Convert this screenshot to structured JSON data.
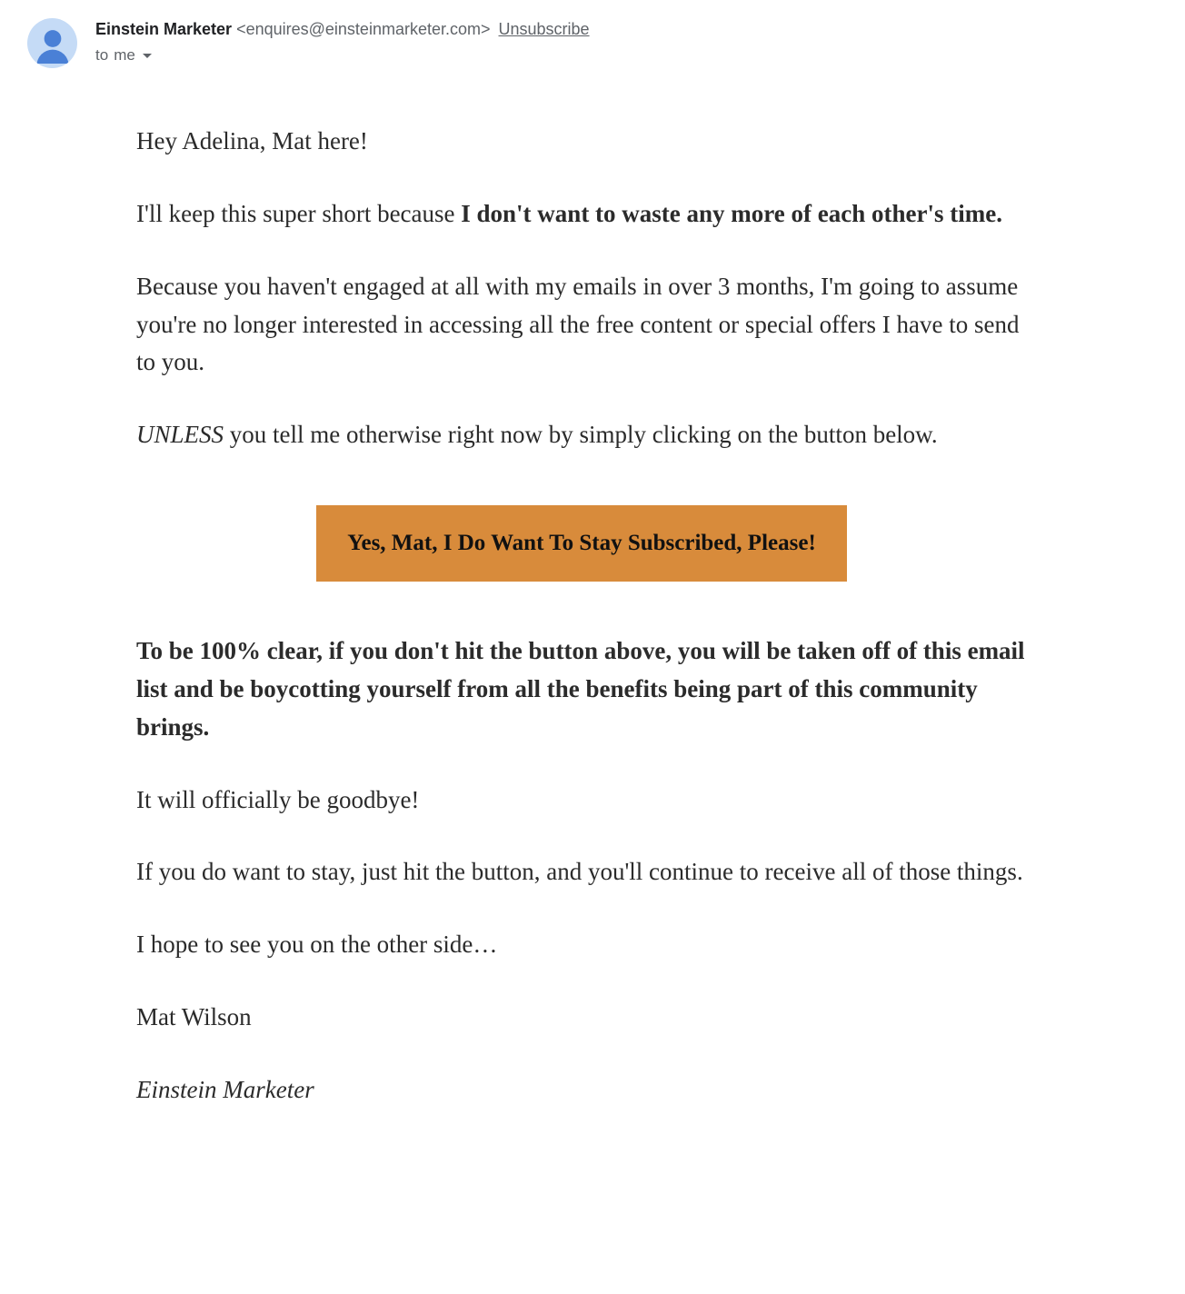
{
  "header": {
    "sender_name": "Einstein Marketer",
    "sender_email": "<enquires@einsteinmarketer.com>",
    "unsubscribe_label": "Unsubscribe",
    "to_prefix": "to",
    "to_recipient": "me"
  },
  "body": {
    "p1": "Hey Adelina, Mat here!",
    "p2_a": "I'll keep this super short because ",
    "p2_b": "I don't want to waste any more of each other's time.",
    "p3": "Because you haven't engaged at all with my emails in over 3 months, I'm going to assume you're no longer interested in accessing all the free content or special offers I have to send to you.",
    "p4_a": "UNLESS",
    "p4_b": " you tell me otherwise right now by simply clicking on the button below.",
    "cta_label": "Yes, Mat, I Do Want To Stay Subscribed, Please!",
    "p5": "To be 100% clear, if you don't hit the button above, you will be taken off of this email list and be boycotting yourself from all the benefits being part of this community brings.",
    "p6": "It will officially be goodbye!",
    "p7": "If you do want to stay, just hit the button, and you'll continue to receive all of those things.",
    "p8": "I hope to see you on the other side…",
    "p9": "Mat Wilson",
    "p10": "Einstein Marketer"
  },
  "colors": {
    "cta_bg": "#d88b3b",
    "avatar_bg": "#c5dbf6"
  }
}
